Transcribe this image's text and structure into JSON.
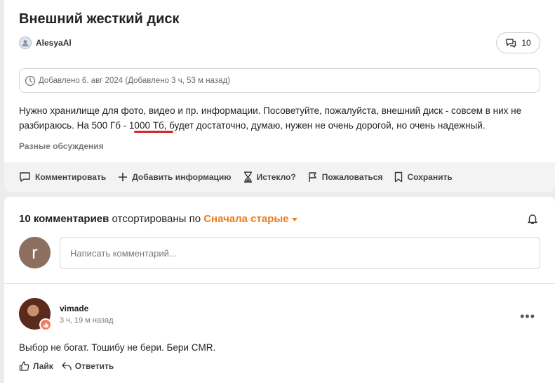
{
  "post": {
    "title": "Внешний жесткий диск",
    "author": "AlesyaAl",
    "comments_count": "10",
    "added_text": "Добавлено 6. авг 2024 (Добавлено 3 ч, 53 м назад)",
    "body_line1": "Нужно хранилище для фото, видео и пр. информации. Посоветуйте, пожалуйста, внешний диск - совсем в них не",
    "body_line2": "разбираюсь. На 500 Гб - 1000 Тб, будет достаточно, думаю, нужен не очень дорогой, но очень надежный.",
    "category": "Разные обсуждения"
  },
  "actions": {
    "comment": "Комментировать",
    "add_info": "Добавить информацию",
    "expired": "Истекло?",
    "report": "Пожаловаться",
    "save": "Сохранить"
  },
  "comments_section": {
    "count_label": "10 комментариев",
    "sorted_by": "отсортированы по",
    "sort_value": "Сначала старые",
    "my_avatar_letter": "r",
    "input_placeholder": "Написать комментарий..."
  },
  "comment": {
    "author": "vimade",
    "time": "3 ч, 19 м назад",
    "text": "Выбор не богат. Тошибу не бери. Бери CMR.",
    "like_label": "Лайк",
    "reply_label": "Ответить"
  },
  "colors": {
    "accent": "#f07b1a",
    "highlight_underline": "#d8232a"
  }
}
